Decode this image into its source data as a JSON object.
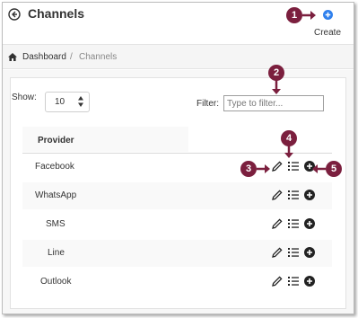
{
  "header": {
    "title": "Channels",
    "create_label": "Create"
  },
  "breadcrumb": {
    "home": "Dashboard",
    "separator": "/",
    "current": "Channels"
  },
  "controls": {
    "show_label": "Show:",
    "show_value": "10",
    "filter_label": "Filter:",
    "filter_placeholder": "Type to filter..."
  },
  "table": {
    "column": "Provider",
    "rows": [
      {
        "name": "Facebook"
      },
      {
        "name": "WhatsApp"
      },
      {
        "name": "SMS"
      },
      {
        "name": "Line"
      },
      {
        "name": "Outlook"
      }
    ]
  },
  "callouts": [
    "1",
    "2",
    "3",
    "4",
    "5"
  ],
  "colors": {
    "accent": "#2f80ed",
    "callout": "#7b1f3e"
  },
  "icons": [
    "back-icon",
    "add-circle-icon",
    "home-icon",
    "pencil-icon",
    "list-icon",
    "plus-circle-icon"
  ]
}
